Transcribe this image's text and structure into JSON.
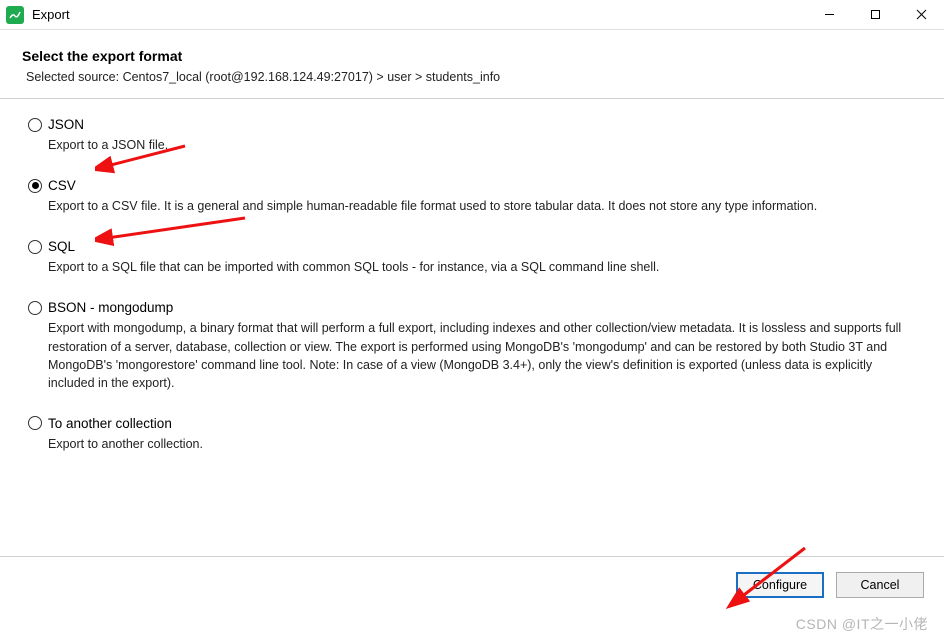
{
  "window": {
    "title": "Export"
  },
  "header": {
    "title": "Select the export format",
    "source_label": "Selected source: Centos7_local (root@192.168.124.49:27017) > user > students_info"
  },
  "options": {
    "json": {
      "label": "JSON",
      "description": "Export to a JSON file."
    },
    "csv": {
      "label": "CSV",
      "description": "Export to a CSV file. It is a general and simple human-readable file format used to store tabular data. It does not store any type information."
    },
    "sql": {
      "label": "SQL",
      "description": "Export to a SQL file that can be imported with common SQL tools - for instance, via a SQL command line shell."
    },
    "bson": {
      "label": "BSON - mongodump",
      "description": "Export with mongodump, a binary format that will perform a full export, including indexes and other collection/view metadata. It is lossless and supports full restoration of a server, database, collection or view. The export is performed using MongoDB's 'mongodump' and can be restored by both Studio 3T and MongoDB's 'mongorestore' command line tool.\nNote: In case of a view (MongoDB 3.4+), only the view's definition is exported (unless data is explicitly included in the export)."
    },
    "another": {
      "label": "To another collection",
      "description": "Export to another collection."
    }
  },
  "footer": {
    "configure": "Configure",
    "cancel": "Cancel"
  },
  "watermark": "CSDN @IT之一小佬"
}
